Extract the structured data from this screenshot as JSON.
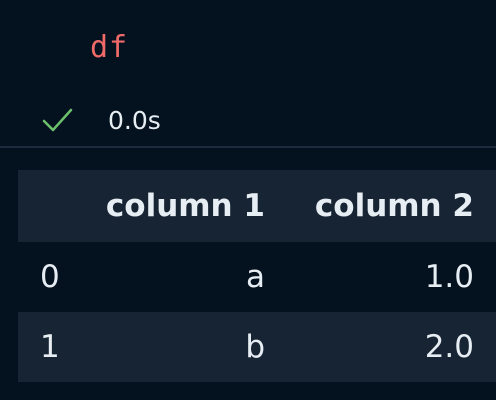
{
  "cell": {
    "code": "df",
    "status": {
      "icon": "checkmark-icon",
      "icon_color": "#6cc06c",
      "elapsed": "0.0s"
    }
  },
  "output_table": {
    "columns": [
      "",
      "column 1",
      "column 2"
    ],
    "rows": [
      {
        "index": "0",
        "column 1": "a",
        "column 2": "1.0"
      },
      {
        "index": "1",
        "column 1": "b",
        "column 2": "2.0"
      }
    ]
  },
  "colors": {
    "background": "#04111f",
    "code_text": "#f06a6a",
    "header_bg": "#172433",
    "text": "#e6edf3"
  }
}
